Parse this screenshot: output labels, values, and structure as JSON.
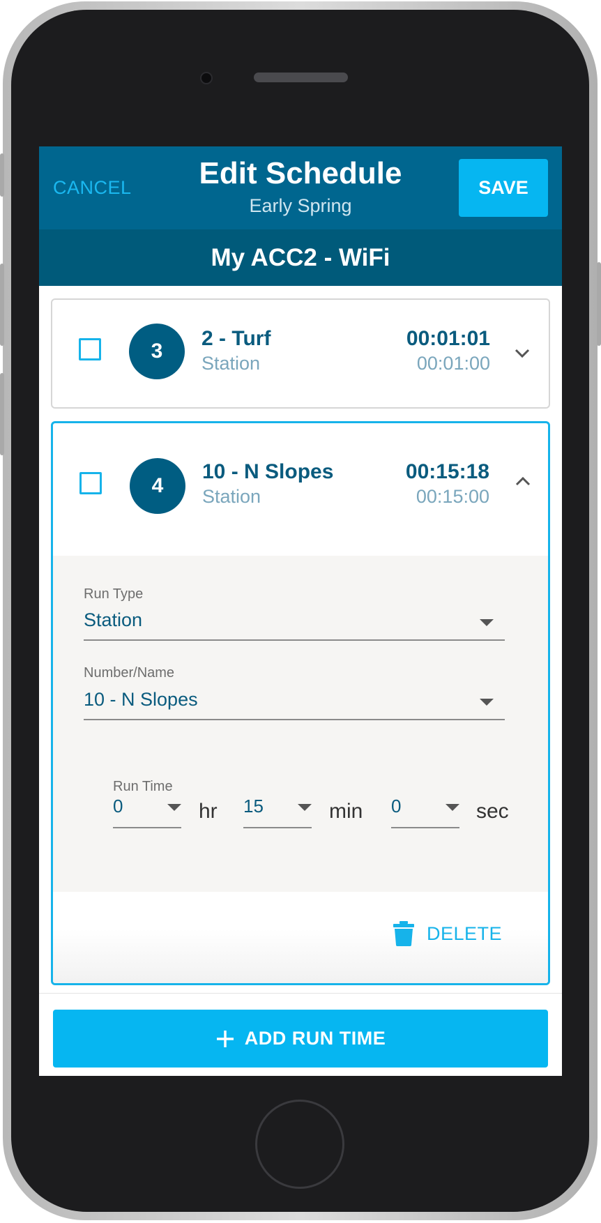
{
  "header": {
    "cancel_label": "CANCEL",
    "title": "Edit Schedule",
    "subtitle": "Early Spring",
    "save_label": "SAVE"
  },
  "controller_name": "My ACC2 - WiFi",
  "run_items": [
    {
      "number": "3",
      "name": "2 - Turf",
      "type": "Station",
      "time_main": "00:01:01",
      "time_sub": "00:01:00",
      "expanded": false
    },
    {
      "number": "4",
      "name": "10 - N Slopes",
      "type": "Station",
      "time_main": "00:15:18",
      "time_sub": "00:15:00",
      "expanded": true
    }
  ],
  "editor": {
    "run_type_label": "Run Type",
    "run_type_value": "Station",
    "number_name_label": "Number/Name",
    "number_name_value": "10 - N Slopes",
    "run_time_label": "Run Time",
    "hours": "0",
    "hours_unit": "hr",
    "minutes": "15",
    "minutes_unit": "min",
    "seconds": "0",
    "seconds_unit": "sec",
    "delete_label": "DELETE"
  },
  "add_run_time_label": "ADD RUN TIME",
  "colors": {
    "header": "#00668f",
    "subheader": "#005a7a",
    "accent": "#06b6f1",
    "text_primary": "#0a5b7e",
    "text_secondary": "#7aa6bc"
  },
  "icons": [
    "checkbox-icon",
    "chevron-down-icon",
    "chevron-up-icon",
    "dropdown-caret-icon",
    "trash-icon",
    "plus-icon"
  ]
}
